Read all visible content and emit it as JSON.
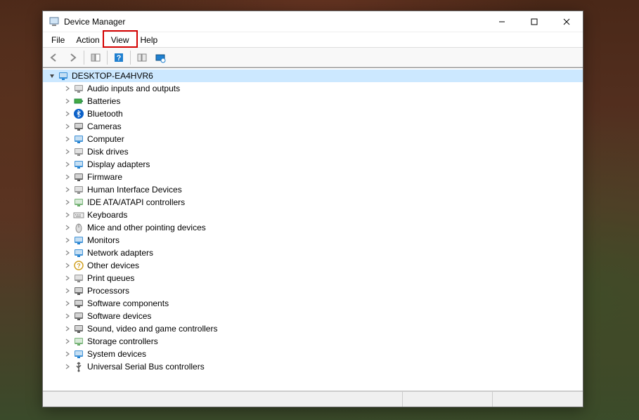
{
  "window": {
    "title": "Device Manager"
  },
  "menu": {
    "items": [
      "File",
      "Action",
      "View",
      "Help"
    ],
    "highlighted_index": 2
  },
  "toolbar": {
    "buttons": [
      "back",
      "forward",
      "show-hide-tree",
      "help",
      "properties",
      "scan-hardware",
      "monitors"
    ]
  },
  "tree": {
    "root": {
      "label": "DESKTOP-EA4HVR6",
      "icon": "computer-icon",
      "expanded": true
    },
    "children": [
      {
        "label": "Audio inputs and outputs",
        "icon": "audio-icon"
      },
      {
        "label": "Batteries",
        "icon": "battery-icon"
      },
      {
        "label": "Bluetooth",
        "icon": "bluetooth-icon"
      },
      {
        "label": "Cameras",
        "icon": "camera-icon"
      },
      {
        "label": "Computer",
        "icon": "computer-monitor-icon"
      },
      {
        "label": "Disk drives",
        "icon": "disk-icon"
      },
      {
        "label": "Display adapters",
        "icon": "display-icon"
      },
      {
        "label": "Firmware",
        "icon": "firmware-icon"
      },
      {
        "label": "Human Interface Devices",
        "icon": "hid-icon"
      },
      {
        "label": "IDE ATA/ATAPI controllers",
        "icon": "ide-icon"
      },
      {
        "label": "Keyboards",
        "icon": "keyboard-icon"
      },
      {
        "label": "Mice and other pointing devices",
        "icon": "mouse-icon"
      },
      {
        "label": "Monitors",
        "icon": "monitor-icon"
      },
      {
        "label": "Network adapters",
        "icon": "network-icon"
      },
      {
        "label": "Other devices",
        "icon": "other-icon"
      },
      {
        "label": "Print queues",
        "icon": "printer-icon"
      },
      {
        "label": "Processors",
        "icon": "processor-icon"
      },
      {
        "label": "Software components",
        "icon": "software-comp-icon"
      },
      {
        "label": "Software devices",
        "icon": "software-dev-icon"
      },
      {
        "label": "Sound, video and game controllers",
        "icon": "sound-icon"
      },
      {
        "label": "Storage controllers",
        "icon": "storage-icon"
      },
      {
        "label": "System devices",
        "icon": "system-icon"
      },
      {
        "label": "Universal Serial Bus controllers",
        "icon": "usb-icon"
      }
    ]
  },
  "icons": {
    "audio-icon": "#888",
    "battery-icon": "#4a4",
    "bluetooth-icon": "#0a60c8",
    "camera-icon": "#555",
    "computer-monitor-icon": "#2080d0",
    "disk-icon": "#888",
    "display-icon": "#2080d0",
    "firmware-icon": "#555",
    "hid-icon": "#888",
    "ide-icon": "#6a6",
    "keyboard-icon": "#888",
    "mouse-icon": "#888",
    "monitor-icon": "#2080d0",
    "network-icon": "#2080d0",
    "other-icon": "#d0a020",
    "printer-icon": "#888",
    "processor-icon": "#555",
    "software-comp-icon": "#555",
    "software-dev-icon": "#555",
    "sound-icon": "#555",
    "storage-icon": "#6a6",
    "system-icon": "#2080d0",
    "usb-icon": "#555",
    "computer-icon": "#2080d0"
  }
}
